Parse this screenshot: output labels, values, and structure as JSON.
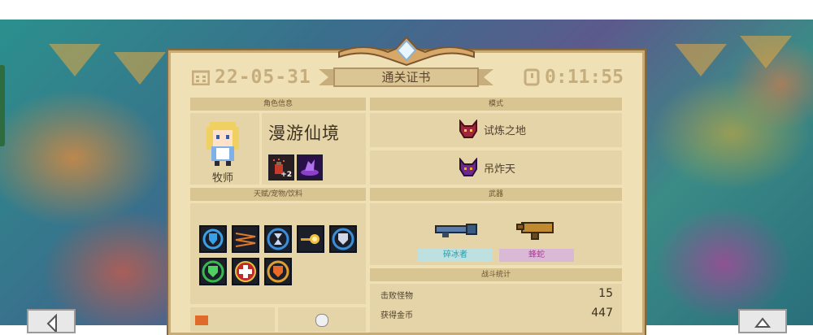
{
  "certificate": {
    "date": "22-05-31",
    "title": "通关证书",
    "time": "0:11:55"
  },
  "character_section": {
    "header": "角色信息",
    "class_name": "牧师",
    "character_name": "漫游仙境",
    "buff_badge": "+2"
  },
  "mode_section": {
    "header": "模式",
    "modes": [
      "试炼之地",
      "吊炸天"
    ]
  },
  "talents_section": {
    "header": "天赋/宠物/饮料",
    "talent_icons": [
      "shield-icon",
      "zigzag-icon",
      "hourglass-icon",
      "explosion-icon",
      "shield-icon",
      "shield-icon",
      "health-cross-icon",
      "fire-shield-icon"
    ]
  },
  "weapons_section": {
    "header": "武器",
    "weapons": [
      "碎冰者",
      "蜂蛇"
    ]
  },
  "stats_section": {
    "header": "战斗统计",
    "stats": [
      {
        "label": "击败怪物",
        "value": "15"
      },
      {
        "label": "获得金币",
        "value": "447"
      }
    ]
  },
  "colors": {
    "panel": "#efe0b6",
    "header_text": "#c6ad7e",
    "weapon1_tag": "#bfe0e0",
    "weapon2_tag": "#d9b9d6"
  }
}
